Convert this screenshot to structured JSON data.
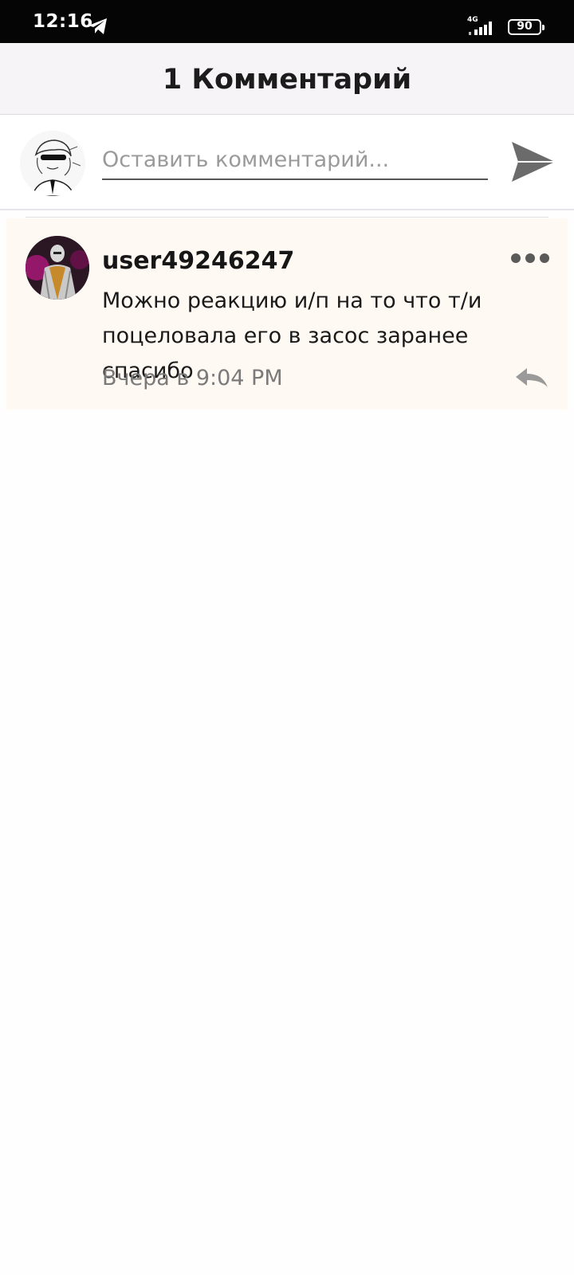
{
  "status_bar": {
    "time": "12:16",
    "network": "4G",
    "battery": "90",
    "icons": [
      "telegram-icon",
      "signal-icon",
      "battery-icon"
    ]
  },
  "header": {
    "title": "1 Комментарий"
  },
  "compose": {
    "placeholder": "Оставить комментарий...",
    "value": "",
    "icons": [
      "avatar",
      "send-icon"
    ]
  },
  "comments": [
    {
      "username": "user49246247",
      "text": "Можно реакцию и/п на то что т/и поцеловала его в засос заранее спасибо",
      "time": "Вчера в 9:04 PM",
      "icons": [
        "more-icon",
        "reply-icon"
      ]
    }
  ],
  "colors": {
    "status_bar_bg": "#050505",
    "header_bg": "#f6f4f6",
    "comment_bg": "#fef9f3",
    "send_icon": "#6b6b6b",
    "muted_text": "#7a7a7a"
  }
}
